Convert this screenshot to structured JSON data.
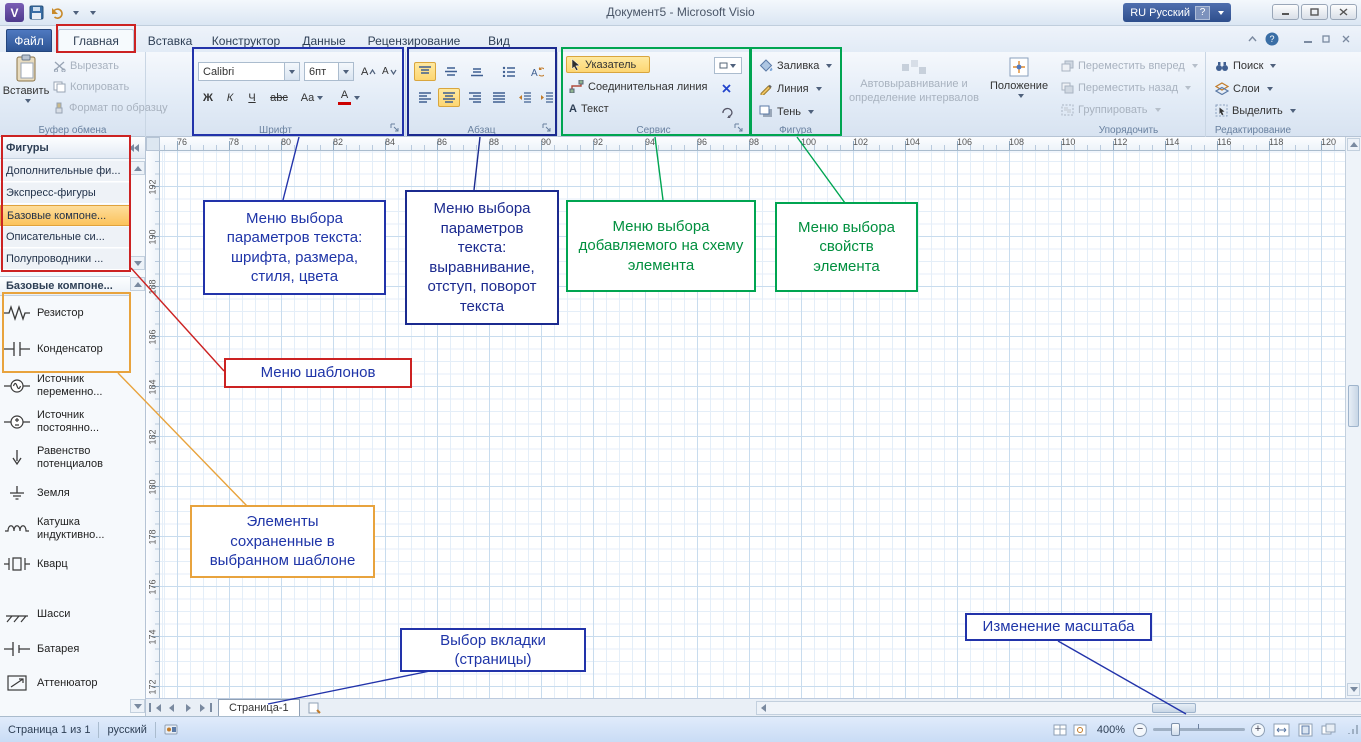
{
  "titlebar": {
    "title": "Документ5  -  Microsoft Visio",
    "language": "RU Русский",
    "language_help": "?"
  },
  "tabs": {
    "file": "Файл",
    "home": "Главная",
    "insert": "Вставка",
    "design": "Конструктор",
    "data": "Данные",
    "review": "Рецензирование",
    "view": "Вид"
  },
  "ribbon": {
    "clipboard": {
      "title": "Буфер обмена",
      "paste": "Вставить",
      "cut": "Вырезать",
      "copy": "Копировать",
      "format_painter": "Формат по образцу"
    },
    "font": {
      "title": "Шрифт",
      "family": "Calibri",
      "size": "6пт",
      "bold": "Ж",
      "italic": "К",
      "underline": "Ч",
      "strikethrough": "abc",
      "case_btn": "Aa",
      "color_btn": "А",
      "grow": "А",
      "shrink": "А"
    },
    "paragraph": {
      "title": "Абзац"
    },
    "tools": {
      "title": "Сервис",
      "pointer": "Указатель",
      "connector": "Соединительная линия",
      "text": "Текст",
      "text_icon": "А"
    },
    "shape": {
      "title": "Фигура",
      "fill": "Заливка",
      "line": "Линия",
      "shadow": "Тень"
    },
    "autoalign": "Автовыравнивание и определение интервалов",
    "position": "Положение",
    "arrange": {
      "title": "Упорядочить",
      "bring_forward": "Переместить вперед",
      "send_backward": "Переместить назад",
      "group": "Группировать"
    },
    "editing": {
      "title": "Редактирование",
      "find": "Поиск",
      "layers": "Слои",
      "select": "Выделить"
    }
  },
  "shapes_panel": {
    "title": "Фигуры",
    "stencils": [
      "Дополнительные фи...",
      "Экспресс-фигуры",
      "Базовые компоне...",
      "Описательные си...",
      "Полупроводники ..."
    ],
    "section": "Базовые компоне...",
    "shapes": [
      "Резистор",
      "Конденсатор",
      "Источник переменно...",
      "Источник постоянно...",
      "Равенство потенциалов",
      "Земля",
      "Катушка индуктивно...",
      "Кварц",
      "Шасси",
      "Батарея",
      "Аттенюатор"
    ]
  },
  "rulers": {
    "horizontal": [
      "76",
      "78",
      "80",
      "82",
      "84",
      "86",
      "88",
      "90",
      "92",
      "94",
      "96",
      "98",
      "100",
      "102",
      "104",
      "106",
      "108",
      "110",
      "112",
      "114",
      "116",
      "118",
      "120"
    ],
    "vertical": [
      "192",
      "190",
      "188",
      "186",
      "184",
      "182",
      "180",
      "178",
      "176",
      "174",
      "172"
    ]
  },
  "pagebar": {
    "tab": "Страница-1"
  },
  "statusbar": {
    "page": "Страница 1 из 1",
    "language": "русский",
    "zoom": "400%"
  },
  "annotations": {
    "font_menu": "Меню выбора параметров текста: шрифта, размера, стиля, цвета",
    "paragraph_menu": "Меню выбора параметров текста: выравнивание, отступ, поворот текста",
    "add_element": "Меню выбора добавляемого на схему элемента",
    "element_props": "Меню выбора свойств элемента",
    "templates": "Меню шаблонов",
    "template_elements": "Элементы сохраненные в выбранном шаблоне",
    "page_tab": "Выбор вкладки (страницы)",
    "zoom": "Изменение масштаба"
  },
  "colors": {
    "annotation_blue": "#2233aa",
    "annotation_navy": "#1b2a8f",
    "annotation_green": "#00a551",
    "annotation_red": "#cc2222",
    "annotation_orange": "#e8a33d",
    "selection_yellow": "#fdd672"
  }
}
